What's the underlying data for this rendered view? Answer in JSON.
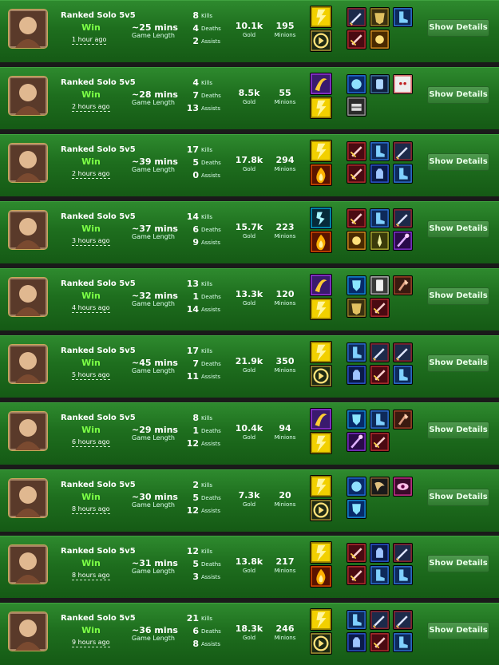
{
  "labels": {
    "kills": "Kills",
    "deaths": "Deaths",
    "assists": "Assists",
    "game_length": "Game Length",
    "gold": "Gold",
    "minions": "Minions",
    "show_details": "Show Details"
  },
  "matches": [
    {
      "queue": "Ranked Solo 5v5",
      "result": "Win",
      "ago": "1 hour ago",
      "length": "~25 mins",
      "kills": "8",
      "deaths": "4",
      "assists": "2",
      "gold": "10.1k",
      "minions": "195",
      "champion_icon": "champion-portrait-icon",
      "spells": [
        "flash-spell-icon",
        "teleport-spell-icon"
      ],
      "items": [
        "sword-item-icon",
        "armor-item-icon",
        "boots-item-icon",
        "blade-item-icon",
        "trinket-item-icon"
      ]
    },
    {
      "queue": "Ranked Solo 5v5",
      "result": "Win",
      "ago": "2 hours ago",
      "length": "~28 mins",
      "kills": "4",
      "deaths": "7",
      "assists": "13",
      "gold": "8.5k",
      "minions": "55",
      "champion_icon": "champion-portrait-icon",
      "spells": [
        "exhaust-spell-icon",
        "flash-spell-icon"
      ],
      "items": [
        "orb-item-icon",
        "relic-item-icon",
        "mask-item-icon",
        "chest-item-icon"
      ]
    },
    {
      "queue": "Ranked Solo 5v5",
      "result": "Win",
      "ago": "2 hours ago",
      "length": "~39 mins",
      "kills": "17",
      "deaths": "5",
      "assists": "0",
      "gold": "17.8k",
      "minions": "294",
      "champion_icon": "champion-portrait-icon",
      "spells": [
        "flash-spell-icon",
        "ignite-spell-icon"
      ],
      "items": [
        "blade-item-icon",
        "boots-item-icon",
        "sword-item-icon",
        "blade-item-icon",
        "gauntlet-item-icon",
        "boots-item-icon"
      ]
    },
    {
      "queue": "Ranked Solo 5v5",
      "result": "Win",
      "ago": "3 hours ago",
      "length": "~37 mins",
      "kills": "14",
      "deaths": "6",
      "assists": "9",
      "gold": "15.7k",
      "minions": "223",
      "champion_icon": "champion-portrait-icon",
      "spells": [
        "ghost-spell-icon",
        "ignite-spell-icon"
      ],
      "items": [
        "blade-item-icon",
        "boots-item-icon",
        "sword-item-icon",
        "trinket-item-icon",
        "dagger-item-icon",
        "staff-item-icon"
      ]
    },
    {
      "queue": "Ranked Solo 5v5",
      "result": "Win",
      "ago": "4 hours ago",
      "length": "~32 mins",
      "kills": "13",
      "deaths": "1",
      "assists": "14",
      "gold": "13.3k",
      "minions": "120",
      "champion_icon": "champion-portrait-icon",
      "spells": [
        "exhaust-spell-icon",
        "flash-spell-icon"
      ],
      "items": [
        "shield-item-icon",
        "card-item-icon",
        "axe-item-icon",
        "armor-item-icon",
        "blade-item-icon"
      ]
    },
    {
      "queue": "Ranked Solo 5v5",
      "result": "Win",
      "ago": "5 hours ago",
      "length": "~45 mins",
      "kills": "17",
      "deaths": "7",
      "assists": "11",
      "gold": "21.9k",
      "minions": "350",
      "champion_icon": "champion-portrait-icon",
      "spells": [
        "flash-spell-icon",
        "teleport-spell-icon"
      ],
      "items": [
        "boots-item-icon",
        "sword-item-icon",
        "sword-item-icon",
        "gauntlet-item-icon",
        "blade-item-icon",
        "boots-item-icon"
      ]
    },
    {
      "queue": "Ranked Solo 5v5",
      "result": "Win",
      "ago": "6 hours ago",
      "length": "~29 mins",
      "kills": "8",
      "deaths": "1",
      "assists": "12",
      "gold": "10.4k",
      "minions": "94",
      "champion_icon": "champion-portrait-icon",
      "spells": [
        "exhaust-spell-icon",
        "flash-spell-icon"
      ],
      "items": [
        "shield-item-icon",
        "boots-item-icon",
        "axe-item-icon",
        "staff-item-icon",
        "blade-item-icon"
      ]
    },
    {
      "queue": "Ranked Solo 5v5",
      "result": "Win",
      "ago": "8 hours ago",
      "length": "~30 mins",
      "kills": "2",
      "deaths": "5",
      "assists": "12",
      "gold": "7.3k",
      "minions": "20",
      "champion_icon": "champion-portrait-icon",
      "spells": [
        "flash-spell-icon",
        "teleport-spell-icon"
      ],
      "items": [
        "orb-item-icon",
        "fang-item-icon",
        "eye-item-icon",
        "shield-item-icon"
      ]
    },
    {
      "queue": "Ranked Solo 5v5",
      "result": "Win",
      "ago": "8 hours ago",
      "length": "~31 mins",
      "kills": "12",
      "deaths": "5",
      "assists": "3",
      "gold": "13.8k",
      "minions": "217",
      "champion_icon": "champion-portrait-icon",
      "spells": [
        "flash-spell-icon",
        "ignite-spell-icon"
      ],
      "items": [
        "blade-item-icon",
        "gauntlet-item-icon",
        "sword-item-icon",
        "blade-item-icon",
        "boots-item-icon",
        "boots-item-icon"
      ]
    },
    {
      "queue": "Ranked Solo 5v5",
      "result": "Win",
      "ago": "9 hours ago",
      "length": "~36 mins",
      "kills": "21",
      "deaths": "6",
      "assists": "8",
      "gold": "18.3k",
      "minions": "246",
      "champion_icon": "champion-portrait-icon",
      "spells": [
        "flash-spell-icon",
        "teleport-spell-icon"
      ],
      "items": [
        "boots-item-icon",
        "sword-item-icon",
        "sword-item-icon",
        "gauntlet-item-icon",
        "blade-item-icon",
        "boots-item-icon"
      ]
    }
  ],
  "colors": {
    "row_top": "#2e8a2e",
    "row_bottom": "#155a15",
    "win": "#7cff46",
    "border_gold": "#c9a85a"
  }
}
